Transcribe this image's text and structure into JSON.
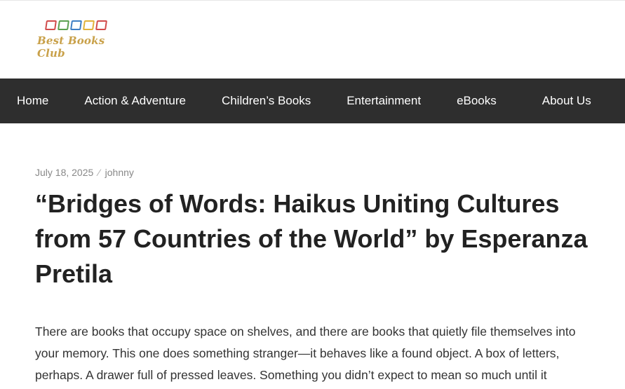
{
  "logo": {
    "text": "Best Books Club",
    "book_colors": [
      "#d14b4b",
      "#5aa04f",
      "#3f7fc4",
      "#e2b23a",
      "#d14b4b"
    ]
  },
  "nav": {
    "items": [
      {
        "label": "Home"
      },
      {
        "label": "Action & Adventure"
      },
      {
        "label": "Children’s Books"
      },
      {
        "label": "Entertainment"
      },
      {
        "label": "eBooks"
      },
      {
        "label": "About Us"
      }
    ]
  },
  "post": {
    "date": "July 18, 2025",
    "separator": "⁄",
    "author": "johnny",
    "title": "“Bridges of Words: Haikus Uniting Cultures from 57 Countries of the World” by Esperanza Pretila",
    "body": "There are books that occupy space on shelves, and there are books that quietly file themselves into your memory. This one does something stranger—it behaves like a found object. A box of letters, perhaps. A drawer full of pressed leaves. Something you didn’t expect to mean so much until it addresses its own subtle echo..."
  },
  "colors": {
    "nav_bg": "#2e2e2e",
    "logo_text": "#c9a14a",
    "title_text": "#222222"
  }
}
